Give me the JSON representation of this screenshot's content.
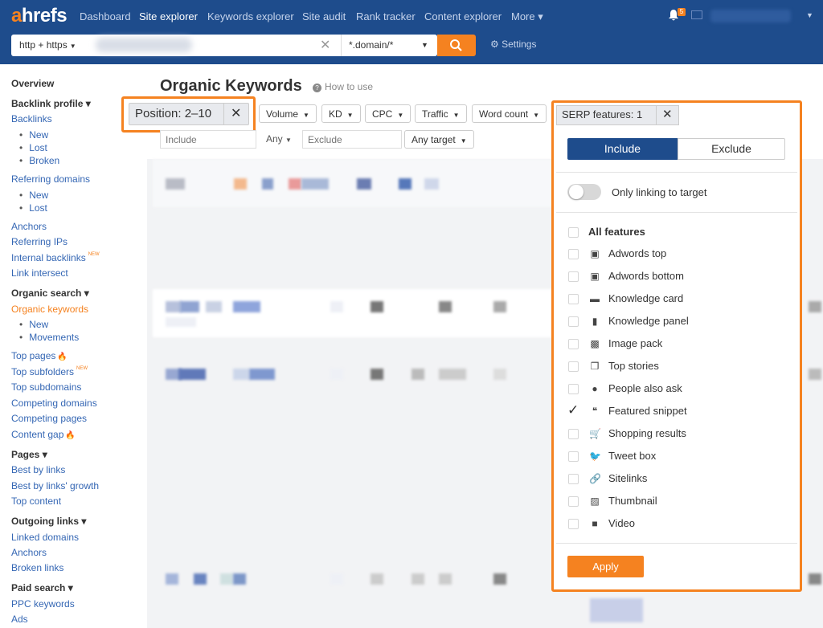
{
  "brand": {
    "logo_a": "a",
    "logo_rest": "hrefs"
  },
  "nav": {
    "items": [
      {
        "label": "Dashboard"
      },
      {
        "label": "Site explorer"
      },
      {
        "label": "Keywords explorer"
      },
      {
        "label": "Site audit"
      },
      {
        "label": "Rank tracker"
      },
      {
        "label": "Content explorer"
      },
      {
        "label": "More ▾"
      }
    ],
    "notification_count": "5"
  },
  "search": {
    "protocol": "http + https",
    "mode": "*.domain/*",
    "settings_label": "Settings"
  },
  "sidebar": {
    "overview": "Overview",
    "backlink_profile": "Backlink profile ▾",
    "backlinks": "Backlinks",
    "new": "New",
    "lost": "Lost",
    "broken": "Broken",
    "referring_domains": "Referring domains",
    "rd_new": "New",
    "rd_lost": "Lost",
    "anchors": "Anchors",
    "referring_ips": "Referring IPs",
    "internal_backlinks": "Internal backlinks",
    "new_tag": "NEW",
    "link_intersect": "Link intersect",
    "organic_search": "Organic search ▾",
    "organic_keywords": "Organic keywords",
    "ok_new": "New",
    "movements": "Movements",
    "top_pages": "Top pages",
    "top_subfolders": "Top subfolders",
    "top_subdomains": "Top subdomains",
    "competing_domains": "Competing domains",
    "competing_pages": "Competing pages",
    "content_gap": "Content gap",
    "pages": "Pages ▾",
    "best_by_links": "Best by links",
    "best_by_links_growth": "Best by links' growth",
    "top_content": "Top content",
    "outgoing_links": "Outgoing links ▾",
    "linked_domains": "Linked domains",
    "out_anchors": "Anchors",
    "broken_links": "Broken links",
    "paid_search": "Paid search ▾",
    "ppc_keywords": "PPC keywords",
    "ads": "Ads"
  },
  "main": {
    "title": "Organic Keywords",
    "how_to_use": "How to use",
    "position_filter": "Position: 2–10",
    "filters": [
      "Volume",
      "KD",
      "CPC",
      "Traffic",
      "Word count"
    ],
    "include_placeholder": "Include",
    "any_label": "Any",
    "exclude_placeholder": "Exclude",
    "any_target": "Any target"
  },
  "serp_panel": {
    "tab_label": "SERP features: 1",
    "include": "Include",
    "exclude": "Exclude",
    "only_linking": "Only linking to target",
    "all_features": "All features",
    "features": [
      {
        "label": "Adwords top",
        "icon": "ad-icon",
        "checked": false
      },
      {
        "label": "Adwords bottom",
        "icon": "ad-icon",
        "checked": false
      },
      {
        "label": "Knowledge card",
        "icon": "card-icon",
        "checked": false
      },
      {
        "label": "Knowledge panel",
        "icon": "panel-icon",
        "checked": false
      },
      {
        "label": "Image pack",
        "icon": "image-icon",
        "checked": false
      },
      {
        "label": "Top stories",
        "icon": "stories-icon",
        "checked": false
      },
      {
        "label": "People also ask",
        "icon": "question-icon",
        "checked": false
      },
      {
        "label": "Featured snippet",
        "icon": "quote-icon",
        "checked": true
      },
      {
        "label": "Shopping results",
        "icon": "cart-icon",
        "checked": false
      },
      {
        "label": "Tweet box",
        "icon": "twitter-icon",
        "checked": false
      },
      {
        "label": "Sitelinks",
        "icon": "link-icon",
        "checked": false
      },
      {
        "label": "Thumbnail",
        "icon": "thumbnail-icon",
        "checked": false
      },
      {
        "label": "Video",
        "icon": "video-icon",
        "checked": false
      }
    ],
    "apply": "Apply"
  },
  "colors": {
    "nav_bg": "#1e4c8c",
    "accent": "#f58220",
    "link": "#3567b4"
  }
}
